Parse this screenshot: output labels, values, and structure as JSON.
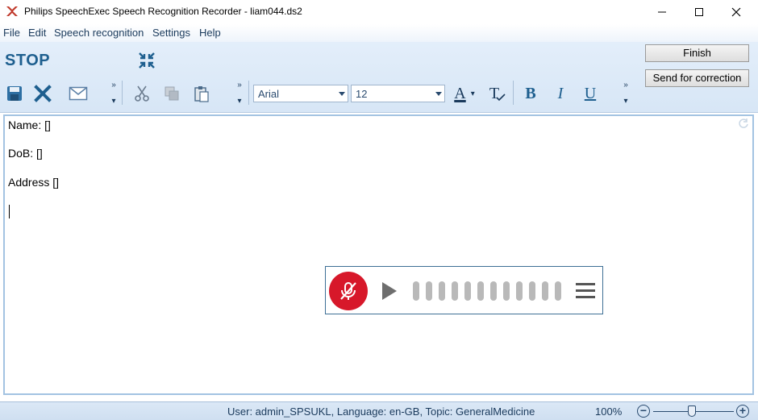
{
  "window": {
    "title": "Philips SpeechExec Speech Recognition Recorder - liam044.ds2",
    "controls": [
      "minimize",
      "maximize",
      "close"
    ]
  },
  "menu": [
    "File",
    "Edit",
    "Speech recognition",
    "Settings",
    "Help"
  ],
  "toolbar": {
    "stop_label": "STOP",
    "font_name": "Arial",
    "font_size": "12",
    "finish_label": "Finish",
    "send_label": "Send for correction",
    "bold_label": "B",
    "italic_label": "I",
    "underline_label": "U",
    "font_color_label": "A",
    "clear_format_label": "T",
    "overflow_label": "»",
    "accent_color": "#1e5f8f"
  },
  "editor": {
    "lines": [
      "Name: []",
      "DoB: []",
      "Address []"
    ]
  },
  "recorder": {
    "mic_color": "#d7182a",
    "bar_count": 12
  },
  "status": {
    "info": "User:  admin_SPSUKL, Language:  en-GB, Topic:  GeneralMedicine",
    "zoom": "100%"
  }
}
